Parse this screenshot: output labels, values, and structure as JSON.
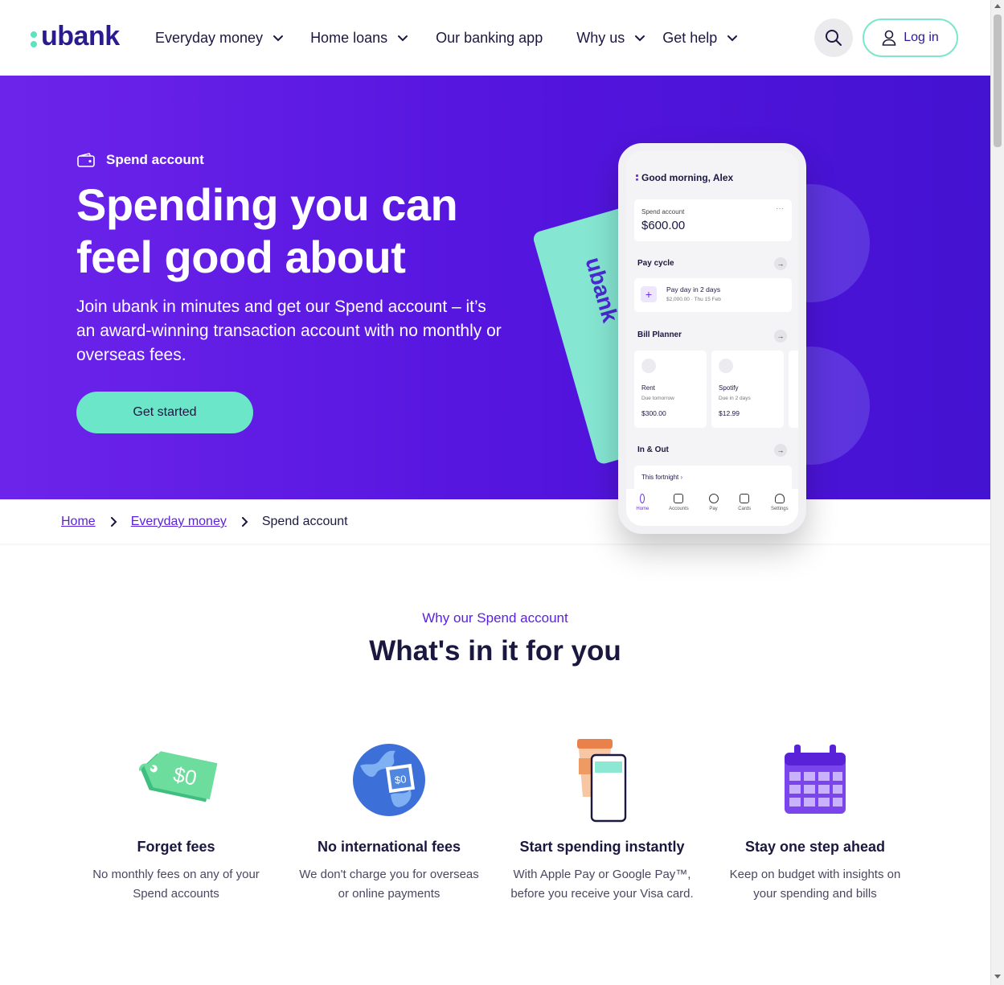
{
  "header": {
    "logo": "ubank",
    "nav": [
      {
        "label": "Everyday money",
        "has_menu": true
      },
      {
        "label": "Home loans",
        "has_menu": true
      },
      {
        "label": "Our banking app",
        "has_menu": false
      },
      {
        "label": "Why us",
        "has_menu": true
      },
      {
        "label": "Get help",
        "has_menu": true
      }
    ],
    "login_label": "Log in"
  },
  "hero": {
    "tag": "Spend account",
    "title": "Spending you can feel good about",
    "subtitle": "Join ubank in minutes and get our Spend account – it’s an award-winning transaction account with no monthly or overseas fees.",
    "cta": "Get started",
    "card_logo": "ubank"
  },
  "phone": {
    "greeting": "Good morning, Alex",
    "account_label": "Spend account",
    "account_balance": "$600.00",
    "pay_cycle": {
      "title": "Pay cycle",
      "item_title": "Pay day in 2 days",
      "item_sub": "$2,000.00 · Thu 15 Feb"
    },
    "bill_planner": {
      "title": "Bill Planner",
      "bills": [
        {
          "name": "Rent",
          "due": "Due tomorrow",
          "amount": "$300.00"
        },
        {
          "name": "Spotify",
          "due": "Due in 2 days",
          "amount": "$12.99"
        }
      ]
    },
    "in_out": {
      "title": "In & Out",
      "period": "This fortnight"
    },
    "tabs": [
      "Home",
      "Accounts",
      "Pay",
      "Cards",
      "Settings"
    ]
  },
  "breadcrumb": {
    "items": [
      "Home",
      "Everyday money"
    ],
    "current": "Spend account"
  },
  "features": {
    "eyebrow": "Why our Spend account",
    "title": "What's in it for you",
    "items": [
      {
        "title": "Forget fees",
        "text": "No monthly fees on any of your Spend accounts",
        "icon": "price-tag-icon",
        "icon_text": "$0"
      },
      {
        "title": "No international fees",
        "text": "We don't charge you for overseas or online payments",
        "icon": "globe-icon",
        "icon_text": "$0"
      },
      {
        "title": "Start spending instantly",
        "text": "With Apple Pay or Google Pay™, before you receive your Visa card.",
        "icon": "phone-coffee-icon"
      },
      {
        "title": "Stay one step ahead",
        "text": "Keep on budget with insights on your spending and bills",
        "icon": "calendar-icon"
      }
    ]
  },
  "colors": {
    "brand_purple": "#5515df",
    "brand_mint": "#6be6c8",
    "link": "#5a1fdc",
    "text_dark": "#1b1840"
  }
}
